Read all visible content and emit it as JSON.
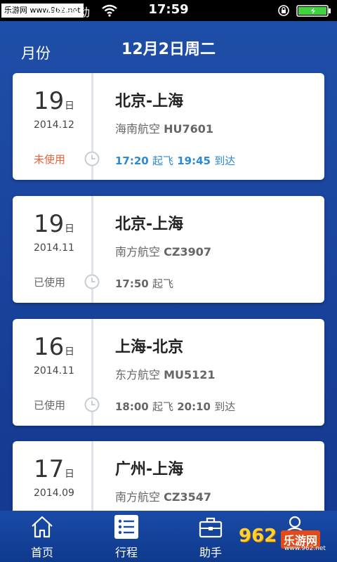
{
  "status_bar": {
    "watermark": "乐游网 www.962.net",
    "carrier": "中国移动",
    "time": "17:59"
  },
  "header": {
    "month_label": "月份",
    "date_title": "12月2日周二"
  },
  "trips": [
    {
      "day": "19",
      "day_unit": "日",
      "year_month": "2014.12",
      "status": "未使用",
      "route": "北京-上海",
      "airline": "海南航空",
      "flight_no": "HU7601",
      "depart_time": "17:20",
      "depart_word": "起飞",
      "arrive_time": "19:45",
      "arrive_word": "到达"
    },
    {
      "day": "19",
      "day_unit": "日",
      "year_month": "2014.11",
      "status": "已使用",
      "route": "北京-上海",
      "airline": "南方航空",
      "flight_no": "CZ3907",
      "depart_time": "17:50",
      "depart_word": "起飞",
      "arrive_time": "",
      "arrive_word": ""
    },
    {
      "day": "16",
      "day_unit": "日",
      "year_month": "2014.11",
      "status": "已使用",
      "route": "上海-北京",
      "airline": "东方航空",
      "flight_no": "MU5121",
      "depart_time": "18:00",
      "depart_word": "起飞",
      "arrive_time": "20:10",
      "arrive_word": "到达"
    },
    {
      "day": "17",
      "day_unit": "日",
      "year_month": "2014.09",
      "status": "",
      "route": "广州-上海",
      "airline": "南方航空",
      "flight_no": "CZ3547",
      "depart_time": "",
      "depart_word": "",
      "arrive_time": "",
      "arrive_word": ""
    }
  ],
  "tabs": [
    {
      "label": "首页",
      "icon": "home-icon"
    },
    {
      "label": "行程",
      "icon": "list-icon",
      "active": true
    },
    {
      "label": "助手",
      "icon": "briefcase-icon"
    },
    {
      "label": "",
      "icon": "person-icon"
    }
  ],
  "watermark_bottom": {
    "badge": "962",
    "text": "乐游网",
    "url": "www.962.net"
  },
  "colors": {
    "background": "#1a45a0",
    "unused_status": "#e8643a",
    "active_times": "#2b8ad6"
  }
}
